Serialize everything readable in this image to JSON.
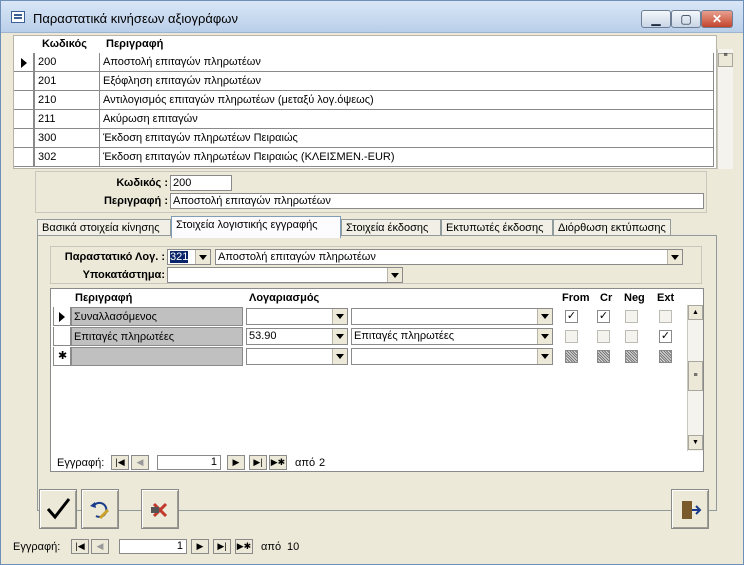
{
  "window": {
    "title": "Παραστατικά κινήσεων αξιογράφων"
  },
  "list": {
    "headers": {
      "code": "Κωδικός",
      "desc": "Περιγραφή"
    },
    "rows": [
      {
        "code": "200",
        "desc": "Αποστολή επιταγών πληρωτέων"
      },
      {
        "code": "201",
        "desc": "Εξόφληση επιταγών πληρωτέων"
      },
      {
        "code": "210",
        "desc": "Αντιλογισμός επιταγών πληρωτέων (μεταξύ λογ.όψεως)"
      },
      {
        "code": "211",
        "desc": "Ακύρωση επιταγών"
      },
      {
        "code": "300",
        "desc": "Έκδοση επιταγών πληρωτέων Πειραιώς"
      },
      {
        "code": "302",
        "desc": "Έκδοση επιταγών πληρωτέων Πειραιώς (ΚΛΕΙΣΜΕΝ.-EUR)"
      }
    ]
  },
  "detail": {
    "code_label": "Κωδικός :",
    "code_value": "200",
    "desc_label": "Περιγραφή :",
    "desc_value": "Αποστολή επιταγών πληρωτέων"
  },
  "tabs": [
    {
      "label": "Βασικά στοιχεία κίνησης"
    },
    {
      "label": "Στοιχεία λογιστικής εγγραφής"
    },
    {
      "label": "Στοιχεία έκδοσης"
    },
    {
      "label": "Εκτυπωτές έκδοσης"
    },
    {
      "label": "Διόρθωση εκτύπωσης"
    }
  ],
  "accounting": {
    "doc_label": "Παραστατικό Λογ. :",
    "doc_code": "321",
    "doc_desc": "Αποστολή επιταγών πληρωτέων",
    "branch_label": "Υποκατάστημα:",
    "branch_value": "",
    "grid": {
      "headers": {
        "desc": "Περιγραφή",
        "account": "Λογαριασμός",
        "from": "From",
        "cr": "Cr",
        "neg": "Neg",
        "ext": "Ext"
      },
      "rows": [
        {
          "desc": "Συναλλασόμενος",
          "account": "",
          "account_desc": "",
          "from": "✓",
          "cr": "✓",
          "neg": "",
          "ext": ""
        },
        {
          "desc": "Επιταγές πληρωτέες",
          "account": "53.90",
          "account_desc": "Επιταγές πληρωτέες",
          "from": "",
          "cr": "",
          "neg": "",
          "ext": "✓"
        }
      ]
    },
    "nav": {
      "label": "Εγγραφή:",
      "current": "1",
      "of": "από",
      "total": "2"
    }
  },
  "bottom_nav": {
    "label": "Εγγραφή:",
    "current": "1",
    "of": "από",
    "total": "10"
  },
  "colors": {
    "title_text": "#000000",
    "accent": "#6e8fb7",
    "delete_red": "#c0392b"
  }
}
